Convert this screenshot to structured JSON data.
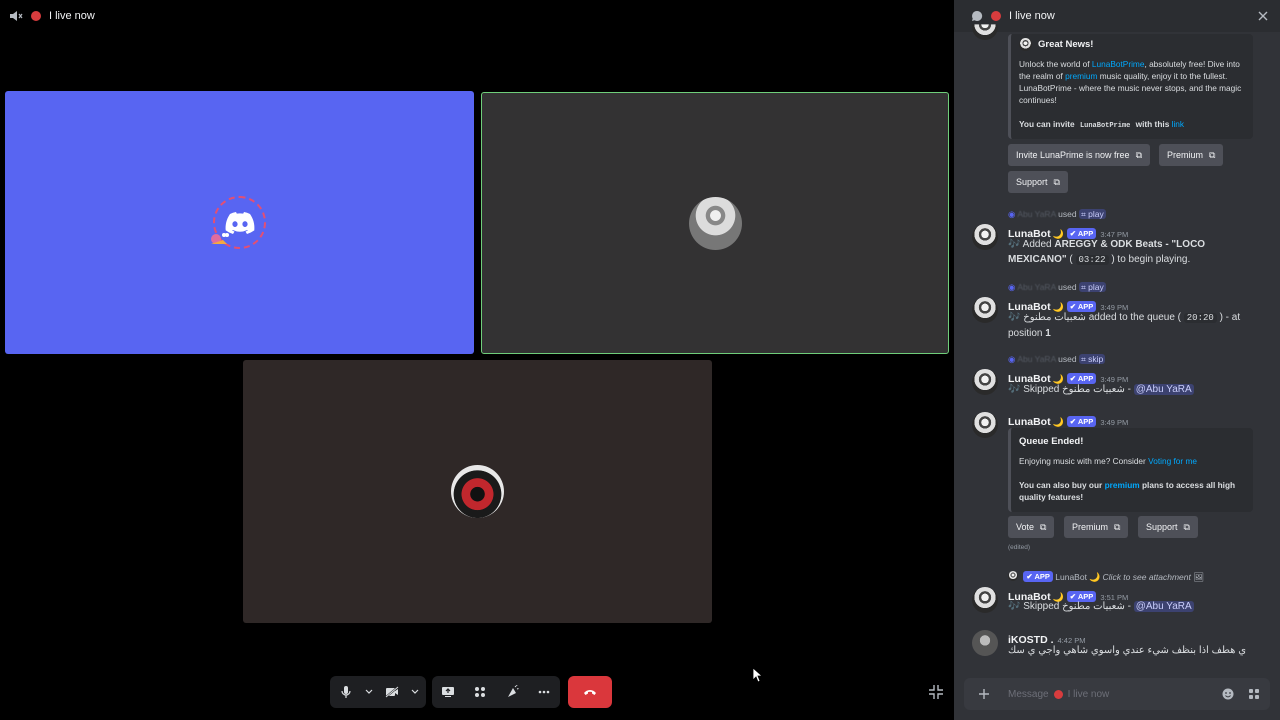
{
  "call": {
    "header_title": "I live now",
    "tiles": [
      {
        "id": "discord-user",
        "color": "#5865f2"
      },
      {
        "id": "speaking-user",
        "color": "#333233",
        "speaking": true
      },
      {
        "id": "third-user",
        "color": "#2f2827"
      }
    ],
    "controls": {
      "mic_label": "mic",
      "camera_label": "camera",
      "share_label": "share-screen",
      "activities_label": "activities",
      "soundboard_label": "soundboard",
      "more_label": "more",
      "end_call_label": "disconnect"
    }
  },
  "chat": {
    "header_title": "I live now",
    "messages": [
      {
        "embed": {
          "title": "Great News!",
          "text_1": "Unlock the world of ",
          "link_1": "LunaBotPrime",
          "text_2": ", absolutely free! Dive into the realm of ",
          "link_2": "premium",
          "text_3": " music quality, enjoy it to the fullest. LunaBotPrime - where the music never stops, and the magic continues!",
          "invite_prefix": "You can invite ",
          "invite_code": "LunaBotPrime",
          "invite_mid": " with this ",
          "invite_link": "link"
        },
        "buttons": [
          "Invite LunaPrime is now free",
          "Premium",
          "Support"
        ]
      },
      {
        "reply_user": "Abu YaRA",
        "reply_used": "used",
        "reply_command": "play",
        "author": "LunaBot",
        "badge": "APP",
        "time": "3:47 PM",
        "text_pre": "🎶 Added ",
        "text_bold": "AREGGY & ODK Beats - \"LOCO MEXICANO\"",
        "text_mid": " ( ",
        "code": "03:22",
        "text_post": " ) to begin playing."
      },
      {
        "reply_user": "Abu YaRA",
        "reply_used": "used",
        "reply_command": "play",
        "author": "LunaBot",
        "badge": "APP",
        "time": "3:49 PM",
        "text_pre": "🎶 شعبيات مطنوخ",
        "text_mid": " added to the queue ( ",
        "code": "20:20",
        "text_post": " ) - at position ",
        "position": "1"
      },
      {
        "reply_user": "Abu YaRA",
        "reply_used": "used",
        "reply_command": "skip",
        "author": "LunaBot",
        "badge": "APP",
        "time": "3:49 PM",
        "text_pre": "🎶 Skipped شعبيات مطنوخ - ",
        "mention": "@Abu YaRA"
      },
      {
        "author": "LunaBot",
        "badge": "APP",
        "time": "3:49 PM",
        "embed": {
          "title": "Queue Ended!",
          "text_1": "Enjoying music with me? Consider ",
          "link_1": "Voting for me",
          "bold_1": "You can also buy our ",
          "link_2": "premium",
          "bold_2": " plans to access all high quality features!"
        },
        "buttons": [
          "Vote",
          "Premium",
          "Support"
        ],
        "edited": "(edited)"
      },
      {
        "reply_badge": "APP",
        "reply_user": "LunaBot",
        "reply_text": "Click to see attachment",
        "author": "LunaBot",
        "badge": "APP",
        "time": "3:51 PM",
        "text_pre": "🎶 Skipped شعبيات مطنوخ - ",
        "mention": "@Abu YaRA"
      },
      {
        "author": "iKOSTD .",
        "time": "4:42 PM",
        "text": "ي هطف اذا بنظف شيء عندي واسوي شاهي واجي ي سك"
      }
    ],
    "composer_placeholder_prefix": "Message",
    "composer_placeholder_channel": "I live now"
  }
}
